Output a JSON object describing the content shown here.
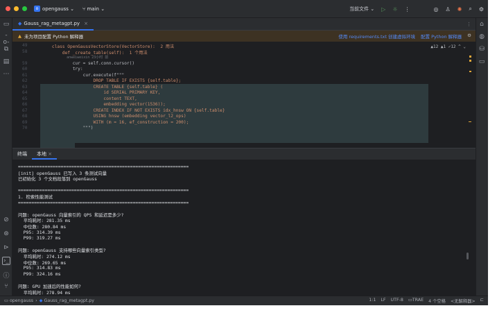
{
  "titlebar": {
    "project": "opengauss",
    "project_badge": "o",
    "branch": "main",
    "run_config": "当前文件",
    "chevron": "⌄"
  },
  "tab": {
    "file": "Gauss_rag_metagpt.py",
    "close": "×"
  },
  "banner": {
    "warn": "未为项目配置 Python 解释器",
    "link1": "使用 requirements.txt 创建虚拟环境",
    "link2": "配置 Python 解释器"
  },
  "inspections": "▲12 ▲1 ✓12 ^ ⌄",
  "code_lines": [
    {
      "n": "49",
      "t": "    class OpenGaussVectorStore(VectorStore):  2 用法"
    },
    {
      "n": "58",
      "t": "        def _create_table(self):  1 个用法"
    },
    {
      "n": "",
      "t": "            anweiweixin 23小时 前"
    },
    {
      "n": "59",
      "t": "            cur = self.conn.cursor()"
    },
    {
      "n": "60",
      "t": "            try:"
    },
    {
      "n": "61",
      "t": "                cur.execute(f\"\"\""
    },
    {
      "n": "62",
      "t": "                    DROP TABLE IF EXISTS {self.table};"
    },
    {
      "n": "63",
      "t": "                    CREATE TABLE {self.table} ("
    },
    {
      "n": "64",
      "t": "                        id SERIAL PRIMARY KEY,"
    },
    {
      "n": "65",
      "t": "                        content TEXT,"
    },
    {
      "n": "66",
      "t": "                        embedding vector(1536));"
    },
    {
      "n": "67",
      "t": "                    CREATE INDEX IF NOT EXISTS idx_hnsw ON {self.table}"
    },
    {
      "n": "68",
      "t": "                    USING hnsw (embedding vector_l2_ops)"
    },
    {
      "n": "69",
      "t": "                    WITH (m = 16, ef_construction = 200);"
    },
    {
      "n": "70",
      "t": "                \"\"\")"
    }
  ],
  "terminal": {
    "tab1": "终端",
    "tab2": "本地",
    "tab_close": "×",
    "lines": [
      "================================================================",
      "[init] openGauss 已写入 3 条测试向量",
      "已初始化 3 个文档段落到 openGauss",
      "",
      "================================================================",
      "1. 检索性能测试",
      "================================================================",
      "",
      "问题: openGauss 向量索引的 QPS 和延迟是多少?",
      "  平均耗时: 281.35 ms",
      "  中位数: 280.84 ms",
      "  P95: 314.39 ms",
      "  P99: 319.27 ms",
      "",
      "问题: openGauss 支持哪些向量索引类型?",
      "  平均耗时: 274.12 ms",
      "  中位数: 269.65 ms",
      "  P95: 314.83 ms",
      "  P99: 324.16 ms",
      "",
      "问题: GPU 加速后的性能如何?",
      "  平均耗时: 278.94 ms"
    ]
  },
  "statusbar": {
    "crumb1": "opengauss",
    "crumb_sep": "›",
    "crumb2": "Gauss_rag_metagpt.py",
    "pos": "1:1",
    "eol": "LF",
    "enc": "UTF-8",
    "git": "TRAE",
    "indent": "4 个空格",
    "interp": "<无解释器>"
  }
}
